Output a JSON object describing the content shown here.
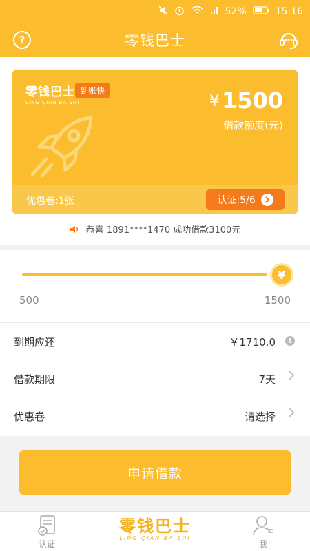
{
  "status_bar": {
    "battery": "52%",
    "time": "15:16"
  },
  "header": {
    "title": "零钱巴士",
    "help_label": "?"
  },
  "card": {
    "logo_cn": "零钱巴士",
    "logo_en": "LING QIAN BA SHI",
    "tag": "到账快",
    "currency": "¥",
    "amount": "1500",
    "amount_label": "借款额度(元)",
    "coupon_count": "优惠卷:1张",
    "verify_label": "认证:5/6"
  },
  "notice": {
    "text": "恭喜 1891****1470 成功借款3100元"
  },
  "slider": {
    "min_label": "500",
    "max_label": "1500",
    "thumb_symbol": "¥",
    "value_fraction": 1.0
  },
  "rows": [
    {
      "label": "到期应还",
      "value": "￥1710.0"
    },
    {
      "label": "借款期限",
      "value": "7天"
    },
    {
      "label": "优惠卷",
      "value": "请选择"
    }
  ],
  "apply_button": "申请借款",
  "tab_bar": {
    "left_label": "认证",
    "logo_cn": "零钱巴士",
    "logo_en": "LING QIAN BA SHI",
    "right_label": "我"
  },
  "colors": {
    "brand": "#fbbd2e",
    "accent": "#f57a1b"
  }
}
